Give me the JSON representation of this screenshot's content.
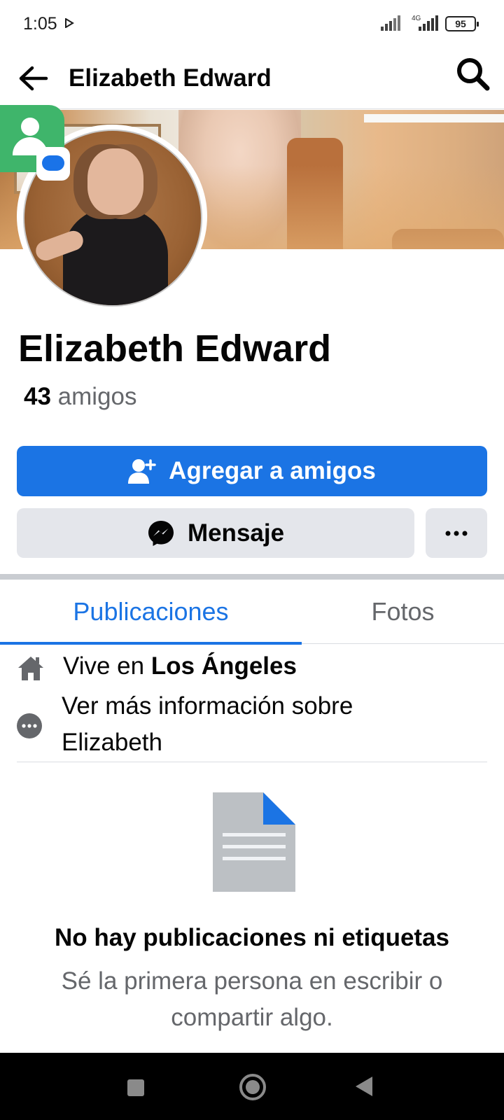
{
  "status_bar": {
    "time": "1:05",
    "network": "4G",
    "battery": "95"
  },
  "header": {
    "title": "Elizabeth Edward",
    "back_icon": "arrow-left-icon",
    "search_icon": "search-icon"
  },
  "profile": {
    "name": "Elizabeth Edward",
    "friends_count": "43",
    "friends_label": "amigos"
  },
  "actions": {
    "add_friend_label": "Agregar a amigos",
    "message_label": "Mensaje",
    "more_label": "···"
  },
  "tabs": [
    {
      "label": "Publicaciones",
      "active": true
    },
    {
      "label": "Fotos",
      "active": false
    }
  ],
  "info": {
    "lives_prefix": "Vive en",
    "lives_city": "Los Ángeles",
    "more_info": "Ver más información sobre Elizabeth"
  },
  "empty_state": {
    "title": "No hay publicaciones ni etiquetas",
    "subtitle": "Sé la primera persona en escribir o compartir algo."
  },
  "colors": {
    "primary": "#1b74e4",
    "secondary_button": "#e4e6eb",
    "muted_text": "#65676b",
    "messages_green": "#3fb56b"
  }
}
